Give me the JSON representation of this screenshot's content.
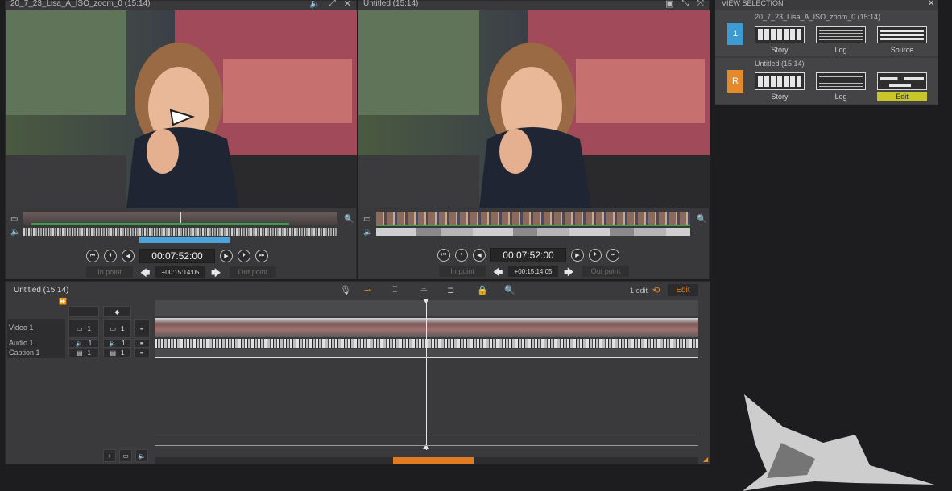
{
  "source_viewer": {
    "title": "20_7_23_Lisa_A_ISO_zoom_0 (15:14)",
    "timecode": "00:07:52:00",
    "offset": "+00:15:14:05",
    "in_point": "In point",
    "out_point": "Out point"
  },
  "record_viewer": {
    "title": "Untitled (15:14)",
    "timecode": "00:07:52:00",
    "offset": "+00:15:14:05",
    "in_point": "In point",
    "out_point": "Out point"
  },
  "timeline": {
    "title": "Untitled (15:14)",
    "edit_count": "1 edit",
    "edit_button": "Edit",
    "tracks": [
      {
        "label": "Video 1",
        "count_a": "1",
        "count_b": "1"
      },
      {
        "label": "Audio 1",
        "count_a": "1",
        "count_b": "1"
      },
      {
        "label": "Caption 1",
        "count_a": "1",
        "count_b": "1"
      }
    ]
  },
  "view_selection": {
    "header": "VIEW SELECTION",
    "rows": [
      {
        "badge": "1",
        "badge_color": "#3d9bd1",
        "name": "20_7_23_Lisa_A_ISO_zoom_0 (15:14)",
        "options": [
          "Story",
          "Log",
          "Source"
        ]
      },
      {
        "badge": "R",
        "badge_color": "#e58a2a",
        "name": "Untitled (15:14)",
        "options": [
          "Story",
          "Log",
          "Edit"
        ]
      }
    ],
    "selected_color": "#c9c62a"
  },
  "icons": [
    "speaker-icon",
    "expand-icon",
    "close-icon",
    "monitor-icon",
    "zoom-icon",
    "play-icon",
    "lock-icon",
    "microphone-icon",
    "history-icon",
    "bird-logo"
  ]
}
